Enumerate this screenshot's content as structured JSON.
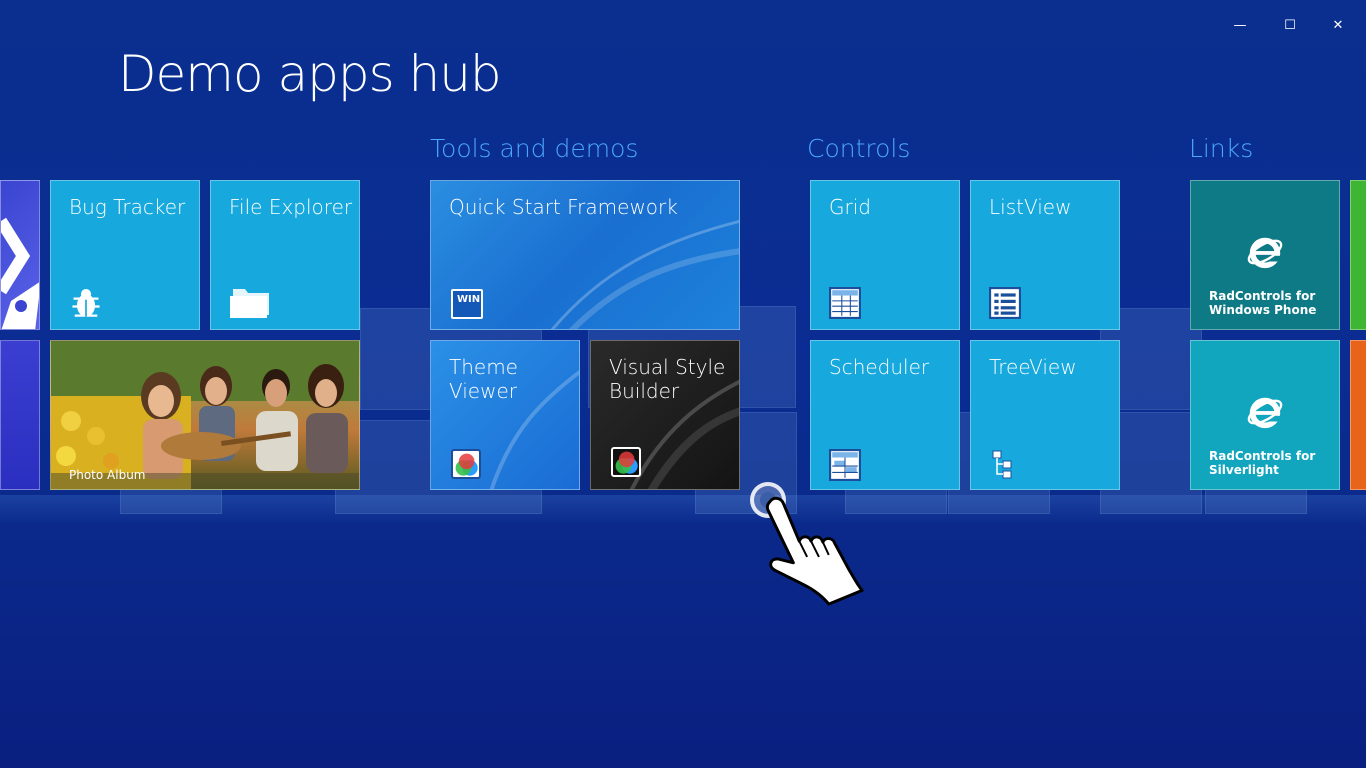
{
  "window": {
    "minimize_label": "—",
    "maximize_label": "☐",
    "close_label": "✕"
  },
  "page": {
    "title": "Demo apps hub"
  },
  "groups": [
    {
      "title": "Tools and demos"
    },
    {
      "title": "Controls"
    },
    {
      "title": "Links"
    }
  ],
  "tiles": {
    "bug_tracker": {
      "label": "Bug Tracker",
      "icon": "bug-icon"
    },
    "file_explorer": {
      "label": "File Explorer",
      "icon": "folder-icon"
    },
    "photo_album": {
      "label": "Photo Album"
    },
    "quick_start": {
      "label": "Quick Start Framework",
      "icon": "win-icon",
      "icon_text": "WIN"
    },
    "theme_viewer": {
      "label": "Theme\nViewer",
      "icon": "palette-icon"
    },
    "visual_style": {
      "label": "Visual Style\nBuilder",
      "icon": "palette-icon"
    },
    "grid": {
      "label": "Grid",
      "icon": "grid-icon"
    },
    "listview": {
      "label": "ListView",
      "icon": "list-icon"
    },
    "scheduler": {
      "label": "Scheduler",
      "icon": "calendar-icon"
    },
    "treeview": {
      "label": "TreeView",
      "icon": "tree-icon"
    },
    "radcontrols_wp": {
      "label": "RadControls for\nWindows Phone",
      "icon": "ie-icon"
    },
    "radcontrols_sl": {
      "label": "RadControls for\nSilverlight",
      "icon": "ie-icon"
    }
  },
  "colors": {
    "background": "#0b2d93",
    "group_title": "#4aa7ff",
    "tile_cyan": "#17a9dd",
    "tile_teal": "#0d7a86",
    "tile_teal_light": "#11a6bd"
  }
}
